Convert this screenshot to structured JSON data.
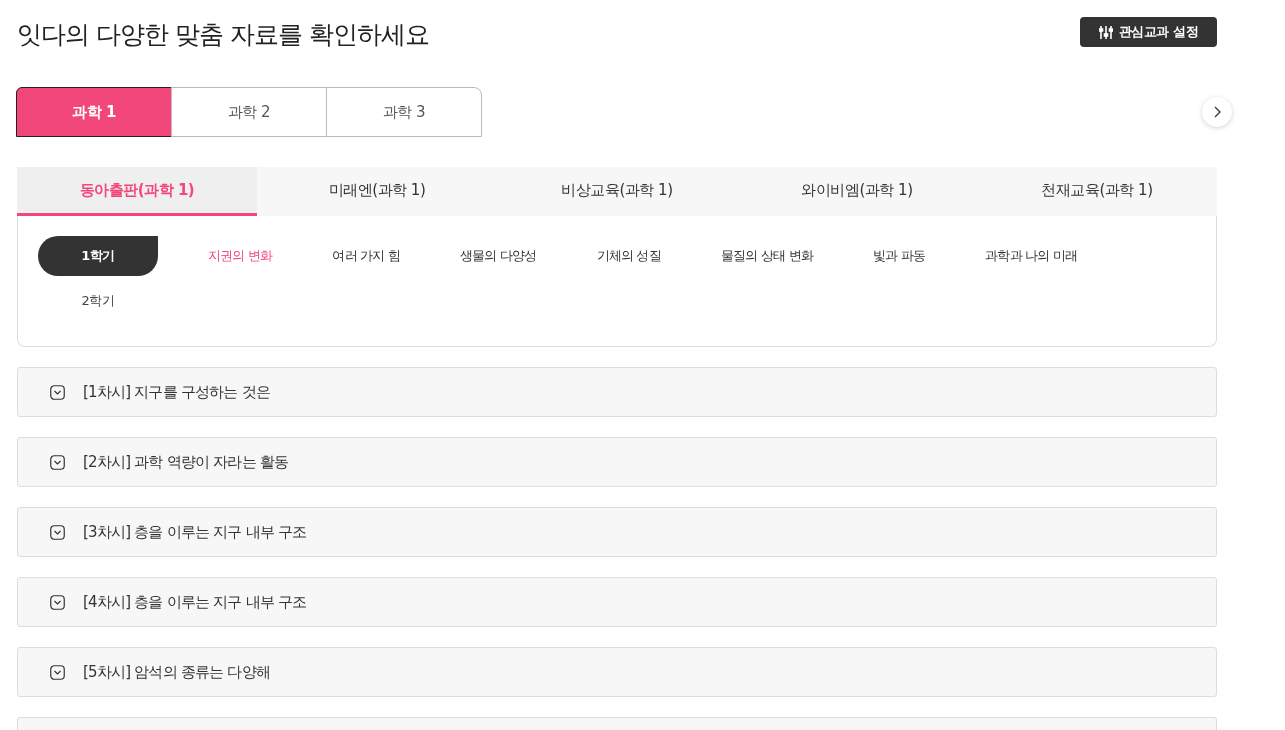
{
  "title": "잇다의 다양한 맞춤 자료를 확인하세요",
  "settings_button": {
    "label": "관심교과 설정"
  },
  "grade_tabs": [
    {
      "label": "과학 1",
      "selected": true
    },
    {
      "label": "과학 2",
      "selected": false
    },
    {
      "label": "과학 3",
      "selected": false
    }
  ],
  "publisher_tabs": [
    {
      "label": "동아출판(과학 1)",
      "selected": true
    },
    {
      "label": "미래엔(과학 1)",
      "selected": false
    },
    {
      "label": "비상교육(과학 1)",
      "selected": false
    },
    {
      "label": "와이비엠(과학 1)",
      "selected": false
    },
    {
      "label": "천재교육(과학 1)",
      "selected": false
    }
  ],
  "semesters": [
    {
      "label": "1학기",
      "selected": true,
      "units": [
        {
          "label": "지권의 변화",
          "selected": true
        },
        {
          "label": "여러 가지 힘",
          "selected": false
        },
        {
          "label": "생물의 다양성",
          "selected": false
        },
        {
          "label": "기체의 성질",
          "selected": false
        },
        {
          "label": "물질의 상태 변화",
          "selected": false
        },
        {
          "label": "빛과 파동",
          "selected": false
        },
        {
          "label": "과학과 나의 미래",
          "selected": false
        }
      ]
    },
    {
      "label": "2학기",
      "selected": false
    }
  ],
  "lessons": [
    {
      "kind": "lesson",
      "title": "[1차시] 지구를 구성하는 것은",
      "expanded": false
    },
    {
      "kind": "lesson",
      "title": "[2차시] 과학 역량이 자라는 활동",
      "expanded": false
    },
    {
      "kind": "lesson",
      "title": "[3차시] 층을 이루는 지구 내부 구조",
      "expanded": false
    },
    {
      "kind": "lesson",
      "title": "[4차시] 층을 이루는 지구 내부 구조",
      "expanded": false
    },
    {
      "kind": "lesson",
      "title": "[5차시] 암석의 종류는 다양해",
      "expanded": false
    },
    {
      "kind": "cut"
    }
  ]
}
